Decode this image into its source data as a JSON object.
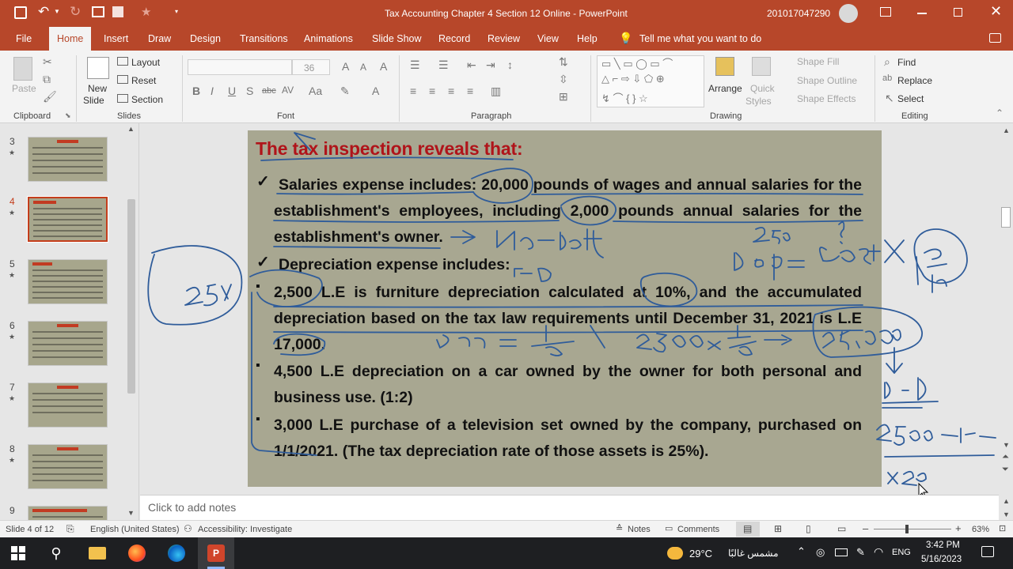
{
  "window": {
    "title": "Tax Accounting Chapter 4 Section 12 Online  -  PowerPoint",
    "user_id": "201017047290"
  },
  "tabs": [
    "File",
    "Home",
    "Insert",
    "Draw",
    "Design",
    "Transitions",
    "Animations",
    "Slide Show",
    "Record",
    "Review",
    "View",
    "Help"
  ],
  "tell_me": "Tell me what you want to do",
  "ribbon": {
    "clipboard": {
      "paste": "Paste",
      "label": "Clipboard"
    },
    "slides": {
      "new_slide_line1": "New",
      "new_slide_line2": "Slide",
      "layout": "Layout",
      "reset": "Reset",
      "section": "Section",
      "label": "Slides"
    },
    "font": {
      "size": "36",
      "label": "Font"
    },
    "paragraph": {
      "label": "Paragraph"
    },
    "drawing": {
      "arrange": "Arrange",
      "quick_styles_1": "Quick",
      "quick_styles_2": "Styles",
      "shape_fill": "Shape Fill",
      "shape_outline": "Shape Outline",
      "shape_effects": "Shape Effects",
      "label": "Drawing"
    },
    "editing": {
      "find": "Find",
      "replace": "Replace",
      "select": "Select",
      "label": "Editing"
    }
  },
  "thumbnails": [
    {
      "num": "3"
    },
    {
      "num": "4"
    },
    {
      "num": "5"
    },
    {
      "num": "6"
    },
    {
      "num": "7"
    },
    {
      "num": "8"
    },
    {
      "num": "9"
    }
  ],
  "slide": {
    "title": "The tax inspection reveals that:",
    "p1": "Salaries expense includes: 20,000 pounds of wages and annual salaries for the establishment's employees, including 2,000 pounds annual salaries for the establishment's owner.",
    "p2": "Depreciation expense includes:",
    "p3": "2,500 L.E is furniture depreciation calculated at 10%, and the accumulated depreciation based on the tax law requirements until December 31, 2021 is L.E 17,000.",
    "p4": "4,500 L.E depreciation on a car owned by the owner for both personal and business use. (1:2)",
    "p5": "3,000 L.E purchase of a television set owned by the company, purchased on 1/1/2021. (The tax depreciation rate of those assets is 25%).",
    "check_mark": "✓",
    "bullet": "▪"
  },
  "notes_placeholder": "Click to add notes",
  "status": {
    "slide_of": "Slide 4 of 12",
    "language": "English (United States)",
    "accessibility": "Accessibility: Investigate",
    "notes": "Notes",
    "comments": "Comments",
    "zoom": "63%",
    "zoom_fraction": 0.43
  },
  "taskbar": {
    "temperature": "29°C",
    "weather": "مشمس غالبًا",
    "lang": "ENG",
    "time": "3:42 PM",
    "date": "5/16/2023"
  }
}
